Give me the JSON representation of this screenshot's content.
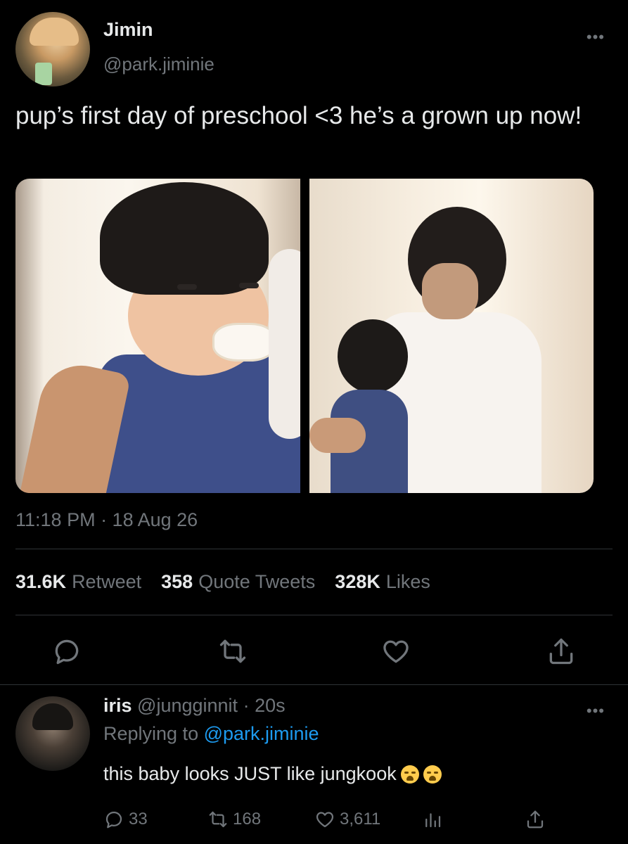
{
  "tweet": {
    "author_name": "Jimin",
    "author_handle": "@park.jiminie",
    "text": "pup’s first day of preschool <3 he’s a grown up now!",
    "timestamp": "11:18 PM · 18 Aug 26",
    "more": "•••",
    "stats": {
      "retweets_count": "31.6K",
      "retweets_label": "Retweet",
      "quotes_count": "358",
      "quotes_label": "Quote Tweets",
      "likes_count": "328K",
      "likes_label": "Likes"
    },
    "actions": [
      "reply-icon",
      "retweet-icon",
      "like-icon",
      "share-icon"
    ]
  },
  "reply": {
    "author_name": "iris",
    "author_handle": "@jungginnit",
    "time": "· 20s",
    "replying_prefix": "Replying to",
    "replying_to": "@park.jiminie",
    "text": "this baby looks JUST like jungkook",
    "emojis": [
      "loudly-crying-face",
      "loudly-crying-face"
    ],
    "more": "•••",
    "reply_count": "33",
    "retweet_count": "168",
    "like_count": "3,611"
  },
  "colors": {
    "background": "#000000",
    "text": "#e7e9ea",
    "muted": "#71767b",
    "link": "#1d9bf0",
    "divider": "#2f3336"
  }
}
